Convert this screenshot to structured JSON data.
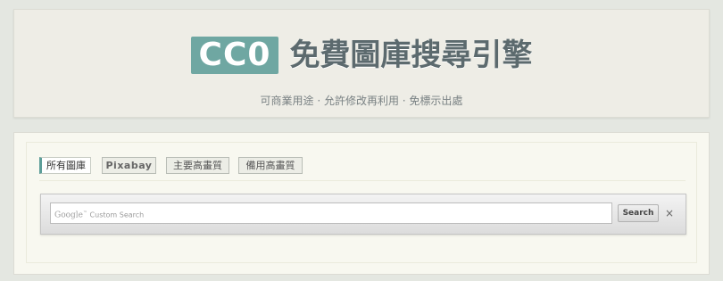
{
  "header": {
    "logo_text": "CC0",
    "title": "免費圖庫搜尋引擎",
    "subtitle": "可商業用途 · 允許修改再利用 · 免標示出處",
    "colors": {
      "logo_bg": "#6fa7a2",
      "title": "#5c6a6e"
    }
  },
  "tabs": [
    {
      "label": "所有圖庫",
      "active": true
    },
    {
      "label": "Pixabay",
      "active": false
    },
    {
      "label": "主要高畫質",
      "active": false
    },
    {
      "label": "備用高畫質",
      "active": false
    }
  ],
  "search": {
    "google_mark": "Google",
    "google_tm": "™",
    "placeholder_suffix": " Custom Search",
    "button_label": "Search",
    "clear_symbol": "×"
  },
  "icons": {
    "clear": "close-icon"
  },
  "colors": {
    "accent": "#5d9e99",
    "page_bg": "#e4e7e1",
    "panel_bg": "#f8f8f0"
  }
}
